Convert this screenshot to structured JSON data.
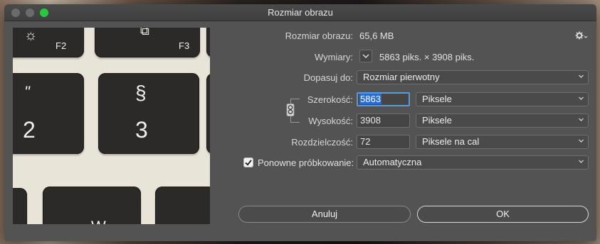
{
  "window": {
    "title": "Rozmiar obrazu"
  },
  "info": {
    "size_label": "Rozmiar obrazu:",
    "size_value": "65,6 MB",
    "dimensions_label": "Wymiary:",
    "dimensions_value": "5863 piks. × 3908 piks."
  },
  "fit": {
    "label": "Dopasuj do:",
    "selected": "Rozmiar pierwotny"
  },
  "width": {
    "label": "Szerokość:",
    "value": "5863",
    "unit": "Piksele"
  },
  "height": {
    "label": "Wysokość:",
    "value": "3908",
    "unit": "Piksele"
  },
  "resolution": {
    "label": "Rozdzielczość:",
    "value": "72",
    "unit": "Piksele na cal"
  },
  "resample": {
    "checked": true,
    "label": "Ponowne próbkowanie:",
    "selected": "Automatyczna"
  },
  "buttons": {
    "cancel": "Anuluj",
    "ok": "OK"
  },
  "preview": {
    "keys": [
      "F2",
      "F3",
      "\"",
      "§",
      "2",
      "3",
      "W"
    ]
  },
  "colors": {
    "dialog_bg": "#535353",
    "focus": "#5b9bd5",
    "selection": "#2a6bd6"
  }
}
